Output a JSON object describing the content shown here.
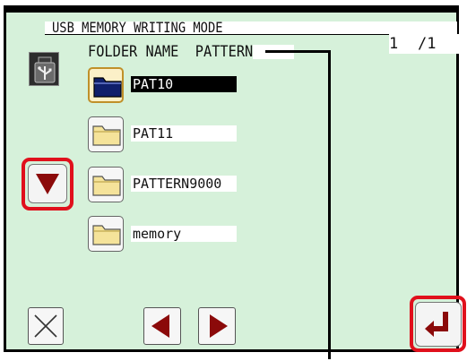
{
  "header": {
    "title": "USB MEMORY WRITING MODE",
    "page_current": "1",
    "page_total": "/1"
  },
  "folder_name": {
    "label": "FOLDER NAME",
    "value": "PATTERN"
  },
  "folders": [
    {
      "label": "PAT10",
      "selected": true
    },
    {
      "label": "PAT11",
      "selected": false
    },
    {
      "label": "PATTERN9000",
      "selected": false
    },
    {
      "label": "memory",
      "selected": false
    }
  ],
  "icons": {
    "usb": "usb-drive-icon",
    "folder": "folder-icon",
    "down": "down-arrow-icon",
    "cancel": "cross-icon",
    "prev": "left-arrow-icon",
    "next": "right-arrow-icon",
    "enter": "enter-icon"
  },
  "colors": {
    "panel_bg": "#d6f1da",
    "arrow_red": "#8b0a0a",
    "highlight_ring": "#e0101c",
    "selected_folder": "#0f1f6b",
    "folder_fill": "#f5e39a"
  }
}
